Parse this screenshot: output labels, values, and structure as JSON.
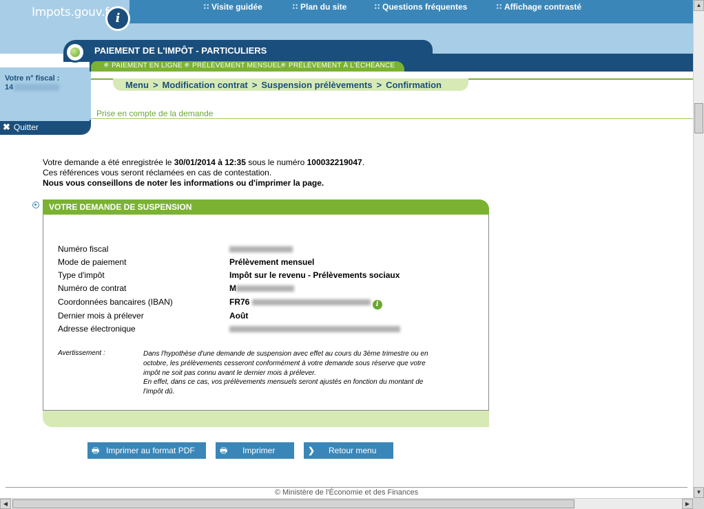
{
  "header": {
    "logo_text": "Impots.gouv.fr",
    "logo_icon": "info-icon",
    "links": [
      "Visite guidée",
      "Plan du site",
      "Questions fréquentes",
      "Affichage contrasté"
    ]
  },
  "title": {
    "text": "PAIEMENT DE L'IMPÔT - PARTICULIERS",
    "tabs": [
      "PAIEMENT EN LIGNE",
      "PRÉLÈVEMENT MENSUEL",
      "PRÉLÈVEMENT À L'ÉCHÉANCE"
    ]
  },
  "left_panel": {
    "label": "Votre n° fiscal :",
    "value_prefix": "14",
    "quit_label": "Quitter"
  },
  "breadcrumb": [
    "Menu",
    "Modification contrat",
    "Suspension prélèvements",
    "Confirmation"
  ],
  "breadcrumb_sep": ">",
  "subtitle": "Prise en compte de la demande",
  "message": {
    "p1_a": "Votre demande a été enregistrée le ",
    "date": "30/01/2014 à 12:35",
    "p1_b": " sous le numéro ",
    "number": "100032219047",
    "p1_c": ".",
    "p2": "Ces références vous seront réclamées en cas de contestation.",
    "p3": "Nous vous conseillons de noter les informations ou d'imprimer la page."
  },
  "section": {
    "title": "VOTRE DEMANDE DE SUSPENSION",
    "rows": [
      {
        "label": "Numéro fiscal",
        "value": ""
      },
      {
        "label": "Mode de paiement",
        "value": "Prélèvement mensuel"
      },
      {
        "label": "Type d'impôt",
        "value": "Impôt sur le revenu - Prélèvements sociaux"
      },
      {
        "label": "Numéro de contrat",
        "value": "M"
      },
      {
        "label": "Coordonnées bancaires (IBAN)",
        "value": "FR76"
      },
      {
        "label": "Dernier mois à prélever",
        "value": "Août"
      },
      {
        "label": "Adresse électronique",
        "value": ""
      }
    ],
    "warning_label": "Avertissement :",
    "warning_lines": [
      "Dans l'hypothèse d'une demande de suspension avec effet au cours du 3ème trimestre ou en",
      "octobre, les prélèvements cesseront conformément à votre demande sous réserve que votre",
      "impôt ne soit pas connu avant le dernier mois à prélever.",
      "En effet, dans ce cas, vos prélèvements mensuels seront ajustés en fonction du montant de",
      "l'impôt dû."
    ]
  },
  "buttons": {
    "pdf": "Imprimer au format PDF",
    "print": "Imprimer",
    "back": "Retour menu"
  },
  "footer": "© Ministère de l'Économie et des Finances",
  "colors": {
    "dark_blue": "#1a4e7c",
    "mid_blue": "#3a86b8",
    "light_blue": "#a8cde6",
    "green": "#7bb232",
    "light_green": "#d7eab6"
  }
}
